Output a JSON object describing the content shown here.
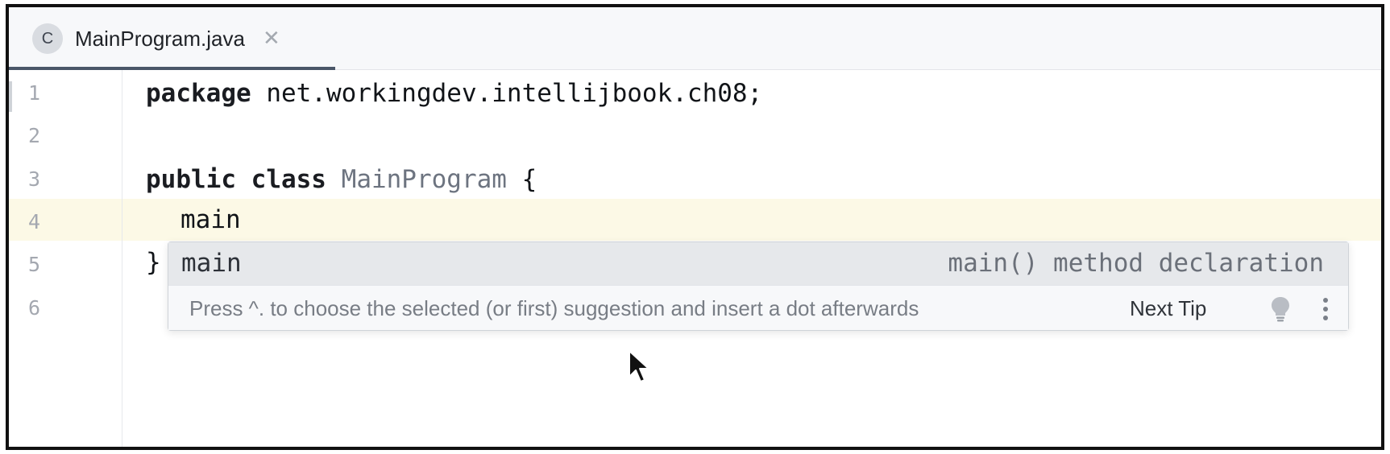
{
  "tab": {
    "icon_letter": "C",
    "title": "MainProgram.java",
    "close_glyph": "✕"
  },
  "gutter": {
    "line_numbers": [
      "1",
      "2",
      "3",
      "4",
      "5",
      "6"
    ]
  },
  "code": {
    "line1": {
      "keyword": "package",
      "rest": " net.workingdev.intellijbook.ch08;"
    },
    "line3": {
      "keyword1": "public",
      "keyword2": "class",
      "class_name": "MainProgram",
      "brace": " {"
    },
    "line4": {
      "text": "main"
    },
    "line5": {
      "text": "}"
    }
  },
  "completion": {
    "suggestion_name": "main",
    "suggestion_description": "main() method declaration",
    "tip_text": "Press ^. to choose the selected (or first) suggestion and insert a dot afterwards",
    "next_tip_label": "Next Tip"
  },
  "icons": {
    "tab_icon": "class-icon",
    "close": "close-icon",
    "tip": "lightbulb-icon",
    "menu": "more-vertical-icon",
    "pointer": "mouse-cursor-icon"
  },
  "colors": {
    "current_line": "#fcf9e6",
    "selected_suggestion": "#e6e8eb",
    "tab_underline": "#4a5668"
  }
}
